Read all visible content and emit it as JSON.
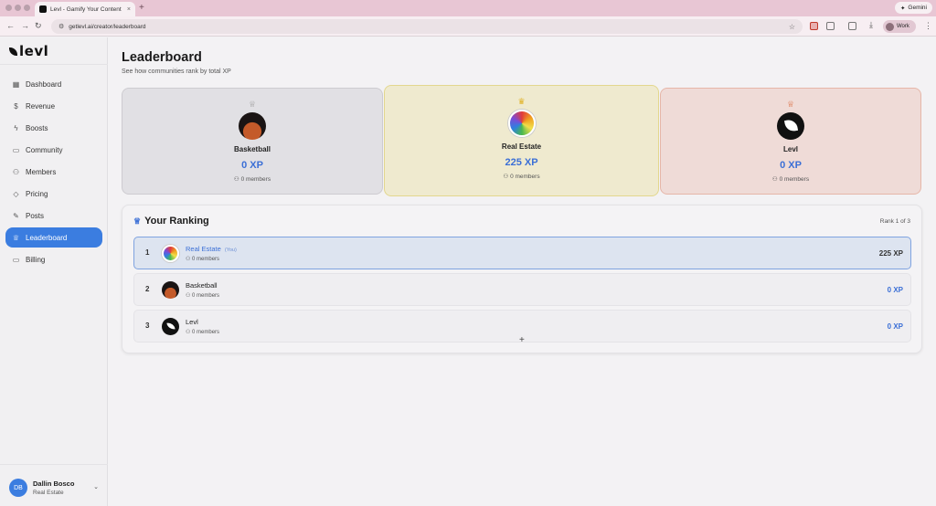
{
  "browser": {
    "tab_title": "Levl - Gamify Your Content",
    "url": "getlevl.ai/creator/leaderboard",
    "gemini_label": "Gemini",
    "profile_label": "Work"
  },
  "sidebar": {
    "logo": "levl",
    "items": [
      {
        "label": "Dashboard",
        "icon": "dashboard-icon"
      },
      {
        "label": "Revenue",
        "icon": "dollar-icon"
      },
      {
        "label": "Boosts",
        "icon": "bolt-icon"
      },
      {
        "label": "Community",
        "icon": "chat-icon"
      },
      {
        "label": "Members",
        "icon": "users-icon"
      },
      {
        "label": "Pricing",
        "icon": "layers-icon"
      },
      {
        "label": "Posts",
        "icon": "edit-icon"
      },
      {
        "label": "Leaderboard",
        "icon": "trophy-icon",
        "active": true
      },
      {
        "label": "Billing",
        "icon": "card-icon"
      }
    ],
    "user": {
      "initials": "DB",
      "name": "Dallin Bosco",
      "community": "Real Estate"
    }
  },
  "page": {
    "title": "Leaderboard",
    "subtitle": "See how communities rank by total XP"
  },
  "podium": [
    {
      "place": 2,
      "name": "Basketball",
      "xp": "0 XP",
      "members": "0 members",
      "medal_color": "#9a9a9a"
    },
    {
      "place": 1,
      "name": "Real Estate",
      "xp": "225 XP",
      "members": "0 members",
      "medal_color": "#e0b020"
    },
    {
      "place": 3,
      "name": "Levl",
      "xp": "0 XP",
      "members": "0 members",
      "medal_color": "#d9683a"
    }
  ],
  "ranking": {
    "title": "Your Ranking",
    "rank_label": "Rank 1 of 3",
    "rows": [
      {
        "rank": "1",
        "name": "Real Estate",
        "you": "(You)",
        "members": "0 members",
        "xp": "225 XP"
      },
      {
        "rank": "2",
        "name": "Basketball",
        "members": "0 members",
        "xp": "0 XP"
      },
      {
        "rank": "3",
        "name": "Levl",
        "members": "0 members",
        "xp": "0 XP"
      }
    ]
  },
  "colors": {
    "accent": "#3b7de0",
    "xp": "#3b6fd6"
  }
}
